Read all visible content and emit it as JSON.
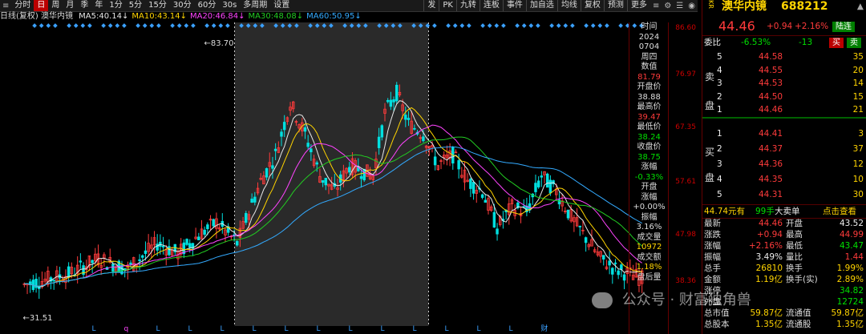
{
  "toolbar": {
    "left_items": [
      "分时",
      "日",
      "周",
      "月",
      "季",
      "年",
      "1分",
      "5分",
      "15分",
      "30分",
      "60分",
      "30s",
      "多周期",
      "设置"
    ],
    "active": "日",
    "right_items": [
      "发",
      "PK",
      "九转",
      "连板",
      "事件",
      "加自选",
      "均线",
      "复权",
      "预测",
      "更多"
    ]
  },
  "ma_line": {
    "prefix": "日线(复权) 澳华内镜",
    "items": [
      {
        "label": "MA5:",
        "value": "40.14↓",
        "color": "#e8e8e8"
      },
      {
        "label": "MA10:",
        "value": "43.14↓",
        "color": "#ffd400"
      },
      {
        "label": "MA20:",
        "value": "46.84↓",
        "color": "#ff44ff"
      },
      {
        "label": "MA30:",
        "value": "48.08↓",
        "color": "#22cc22"
      },
      {
        "label": "MA60:",
        "value": "50.95↓",
        "color": "#33aaff"
      }
    ]
  },
  "chart": {
    "high_marker": "83.70",
    "low_marker": "31.51",
    "axis_labels": [
      "86.60",
      "76.97",
      "67.35",
      "57.61",
      "47.98",
      "38.36"
    ],
    "bottom_markers": [
      "L",
      "q",
      "L",
      "L",
      "L",
      "L",
      "L",
      "L",
      "L",
      "L",
      "L",
      "L",
      "L",
      "L",
      "财"
    ]
  },
  "info_column": {
    "items": [
      {
        "label": "时间",
        "value": "2024",
        "color": "#ddd"
      },
      {
        "label": "",
        "value": "0704",
        "color": "#ddd"
      },
      {
        "label": "周四",
        "value": "",
        "color": "#ddd"
      },
      {
        "label": "数值",
        "value": "",
        "color": "#ddd"
      },
      {
        "label": "",
        "value": "81.79",
        "color": "#ff3b3b"
      },
      {
        "label": "开盘价",
        "value": "",
        "color": "#ddd"
      },
      {
        "label": "",
        "value": "38.88",
        "color": "#ddd"
      },
      {
        "label": "最高价",
        "value": "",
        "color": "#ddd"
      },
      {
        "label": "",
        "value": "39.47",
        "color": "#ff3b3b"
      },
      {
        "label": "最低价",
        "value": "",
        "color": "#ddd"
      },
      {
        "label": "",
        "value": "38.24",
        "color": "#00e000"
      },
      {
        "label": "收盘价",
        "value": "",
        "color": "#ddd"
      },
      {
        "label": "",
        "value": "38.75",
        "color": "#00e000"
      },
      {
        "label": "涨幅",
        "value": "",
        "color": "#ddd"
      },
      {
        "label": "",
        "value": "-0.33%",
        "color": "#00e000"
      },
      {
        "label": "开盘",
        "value": "",
        "color": "#ddd"
      },
      {
        "label": "涨幅",
        "value": "",
        "color": "#ddd"
      },
      {
        "label": "",
        "value": "+0.00%",
        "color": "#ddd"
      },
      {
        "label": "振幅",
        "value": "",
        "color": "#ddd"
      },
      {
        "label": "",
        "value": "3.16%",
        "color": "#ddd"
      },
      {
        "label": "成交量",
        "value": "",
        "color": "#ddd"
      },
      {
        "label": "",
        "value": "10972",
        "color": "#ffd400"
      },
      {
        "label": "成交额",
        "value": "",
        "color": "#ddd"
      },
      {
        "label": "",
        "value": "",
        "color": "#ddd"
      },
      {
        "label": "",
        "value": "",
        "color": "#ddd"
      },
      {
        "label": "",
        "value": "1.18%",
        "color": "#ffd400"
      },
      {
        "label": "盘后量",
        "value": "",
        "color": "#ddd"
      }
    ]
  },
  "stock": {
    "side_tag": "KR",
    "name": "澳华内镜",
    "code": "688212",
    "price": "44.46",
    "change": "+0.94",
    "change_pct": "+2.16%",
    "badge": "陆连",
    "webi_label": "委比",
    "webi_value": "-6.53%",
    "weicha": "-13",
    "buy_btn": "买",
    "sell_btn": "卖"
  },
  "sell_side_label": [
    "卖",
    "盘"
  ],
  "buy_side_label": [
    "买",
    "盘"
  ],
  "asks": [
    {
      "level": "5",
      "price": "44.58",
      "vol": "35"
    },
    {
      "level": "4",
      "price": "44.55",
      "vol": "20"
    },
    {
      "level": "3",
      "price": "44.53",
      "vol": "14"
    },
    {
      "level": "2",
      "price": "44.50",
      "vol": "15"
    },
    {
      "level": "1",
      "price": "44.46",
      "vol": "21"
    }
  ],
  "bids": [
    {
      "level": "1",
      "price": "44.41",
      "vol": "3"
    },
    {
      "level": "2",
      "price": "44.37",
      "vol": "37"
    },
    {
      "level": "3",
      "price": "44.36",
      "vol": "12"
    },
    {
      "level": "4",
      "price": "44.35",
      "vol": "10"
    },
    {
      "level": "5",
      "price": "44.31",
      "vol": "30"
    }
  ],
  "big_order": {
    "price": "44.74元有",
    "hands": "99手",
    "label": "大卖单",
    "link": "点击查看"
  },
  "stats": [
    {
      "l1": "最新",
      "v1": "44.46",
      "c1": "#ff3b3b",
      "l2": "开盘",
      "v2": "43.52",
      "c2": "#eee"
    },
    {
      "l1": "涨跌",
      "v1": "+0.94",
      "c1": "#ff3b3b",
      "l2": "最高",
      "v2": "44.99",
      "c2": "#ff3b3b"
    },
    {
      "l1": "涨幅",
      "v1": "+2.16%",
      "c1": "#ff3b3b",
      "l2": "最低",
      "v2": "43.47",
      "c2": "#00e000"
    },
    {
      "l1": "振幅",
      "v1": "3.49%",
      "c1": "#eee",
      "l2": "量比",
      "v2": "1.44",
      "c2": "#ff3b3b"
    },
    {
      "l1": "总手",
      "v1": "26810",
      "c1": "#ffd400",
      "l2": "换手",
      "v2": "1.99%",
      "c2": "#ffd400"
    },
    {
      "l1": "金额",
      "v1": "1.19亿",
      "c1": "#ffd400",
      "l2": "换手(实)",
      "v2": "2.89%",
      "c2": "#ffd400"
    },
    {
      "l1": "涨停",
      "v1": "",
      "c1": "#ff3b3b",
      "l2": "",
      "v2": "34.82",
      "c2": "#00e000"
    },
    {
      "l1": "外盘",
      "v1": "",
      "c1": "#ff3b3b",
      "l2": "",
      "v2": "12724",
      "c2": "#00e000"
    },
    {
      "l1": "总市值",
      "v1": "59.87亿",
      "c1": "#ffd400",
      "l2": "流通值",
      "v2": "59.87亿",
      "c2": "#ffd400"
    },
    {
      "l1": "总股本",
      "v1": "1.35亿",
      "c1": "#ffd400",
      "l2": "流通股",
      "v2": "1.35亿",
      "c2": "#ffd400"
    }
  ],
  "watermark": "公众号 · 财富独角兽"
}
